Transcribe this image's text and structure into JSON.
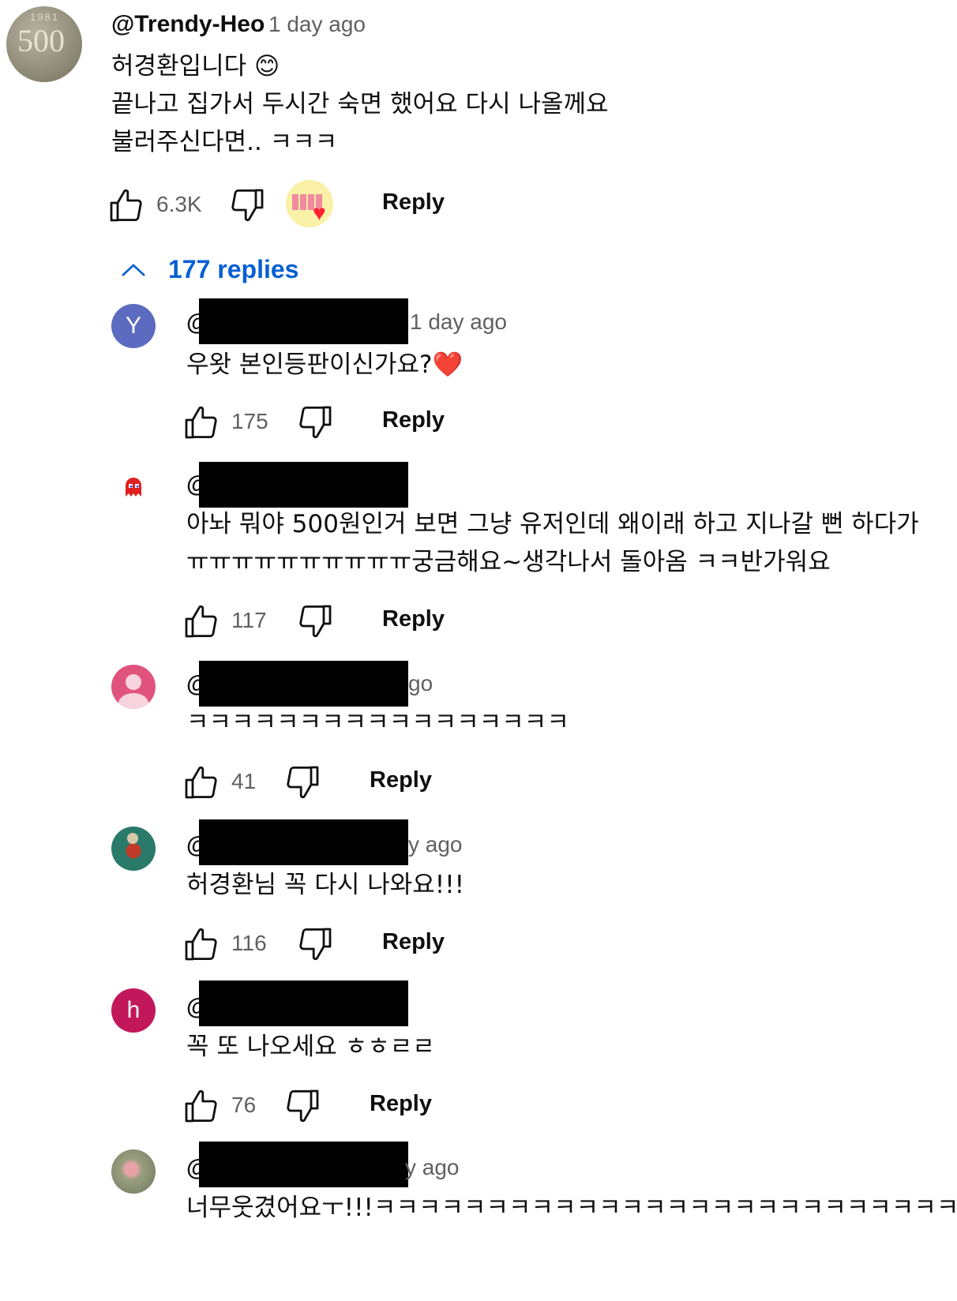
{
  "top_comment": {
    "handle": "@Trendy-Heo",
    "time": "1 day ago",
    "lines": [
      "허경환입니다 😊",
      "끝나고 집가서 두시간 숙면 했어요 다시 나올께요",
      "불러주신다면..  ㅋㅋㅋ"
    ],
    "likes": "6.3K",
    "reply_label": "Reply",
    "coin_year": "1981",
    "coin_value": "500"
  },
  "replies_toggle": {
    "label": "177 replies",
    "icon": "chevron-up-icon"
  },
  "replies": [
    {
      "avatar_letter": "Y",
      "avatar_color": "#5c6bc0",
      "at": "@",
      "time": "1 day ago",
      "lines": [
        "우왓 본인등판이신가요?❤️"
      ],
      "likes": "175",
      "reply_label": "Reply"
    },
    {
      "avatar_letter": "",
      "avatar_color": "#ffffff",
      "at": "@",
      "time": "",
      "lines": [
        "아놔 뭐야 500원인거 보면 그냥 유저인데 왜이래 하고 지나갈 뻔 하다가",
        "ㅠㅠㅠㅠㅠㅠㅠㅠㅠㅠ궁금해요~생각나서 돌아옴 ㅋㅋ반가워요"
      ],
      "likes": "117",
      "reply_label": "Reply"
    },
    {
      "avatar_letter": "",
      "avatar_color": "#e0537d",
      "at": "@",
      "time": "go",
      "lines": [
        "ㅋㅋㅋㅋㅋㅋㅋㅋㅋㅋㅋㅋㅋㅋㅋㅋㅋ"
      ],
      "likes": "41",
      "reply_label": "Reply"
    },
    {
      "avatar_letter": "",
      "avatar_color": "#2a7a6a",
      "at": "@",
      "time": "y ago",
      "lines": [
        "허경환님 꼭 다시 나와요!!!"
      ],
      "likes": "116",
      "reply_label": "Reply"
    },
    {
      "avatar_letter": "h",
      "avatar_color": "#c2185b",
      "at": "@",
      "time": "",
      "lines": [
        "꼭 또 나오세요 ㅎㅎㄹㄹ"
      ],
      "likes": "76",
      "reply_label": "Reply"
    },
    {
      "avatar_letter": "",
      "avatar_color": "#8a8f7a",
      "at": "@",
      "time": "y ago",
      "lines": [
        "너무웃겼어요ㅜ!!!ㅋㅋㅋㅋㅋㅋㅋㅋㅋㅋㅋㅋㅋㅋㅋㅋㅋㅋㅋㅋㅋㅋㅋㅋㅋㅋㅋ"
      ]
    }
  ],
  "colors": {
    "link": "#065fd4",
    "secondary": "#606060"
  }
}
